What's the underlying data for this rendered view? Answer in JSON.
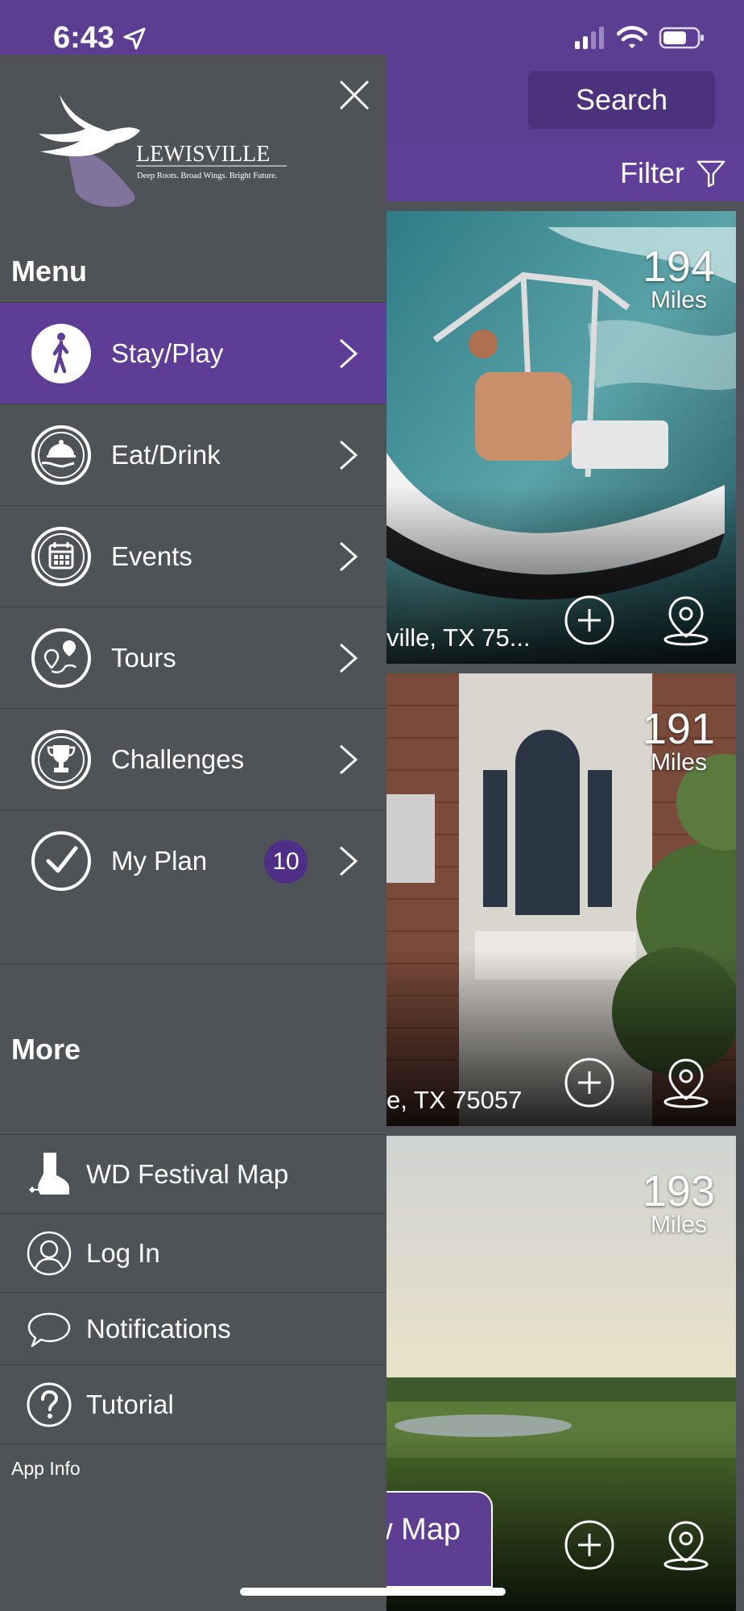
{
  "status_bar": {
    "time": "6:43"
  },
  "header": {
    "search_label": "Search",
    "filter_label": "Filter"
  },
  "cards": [
    {
      "distance": "194",
      "unit": "Miles",
      "address": "ville, TX 75..."
    },
    {
      "distance": "191",
      "unit": "Miles",
      "address": "e, TX 75057"
    },
    {
      "distance": "193",
      "unit": "Miles",
      "address": ""
    }
  ],
  "map_button": {
    "label": "w Map"
  },
  "drawer": {
    "logo_name": "LEWISVILLE",
    "logo_tagline": "Deep Roots. Broad Wings. Bright Future.",
    "menu_title": "Menu",
    "menu_items": [
      {
        "label": "Stay/Play",
        "icon": "walking-person-icon",
        "active": true
      },
      {
        "label": "Eat/Drink",
        "icon": "serving-dish-icon"
      },
      {
        "label": "Events",
        "icon": "calendar-icon"
      },
      {
        "label": "Tours",
        "icon": "route-icon"
      },
      {
        "label": "Challenges",
        "icon": "trophy-icon"
      },
      {
        "label": "My Plan",
        "icon": "checkmark-icon",
        "badge": "10"
      }
    ],
    "more_title": "More",
    "more_items": [
      {
        "label": "WD Festival Map",
        "icon": "cowboy-boot-icon"
      },
      {
        "label": "Log In",
        "icon": "user-icon"
      },
      {
        "label": "Notifications",
        "icon": "speech-bubble-icon"
      },
      {
        "label": "Tutorial",
        "icon": "question-icon"
      }
    ],
    "app_info": "App Info"
  },
  "colors": {
    "brand_purple": "#5b3d92",
    "drawer_bg": "#4f5256",
    "badge_purple": "#4e2e86"
  }
}
